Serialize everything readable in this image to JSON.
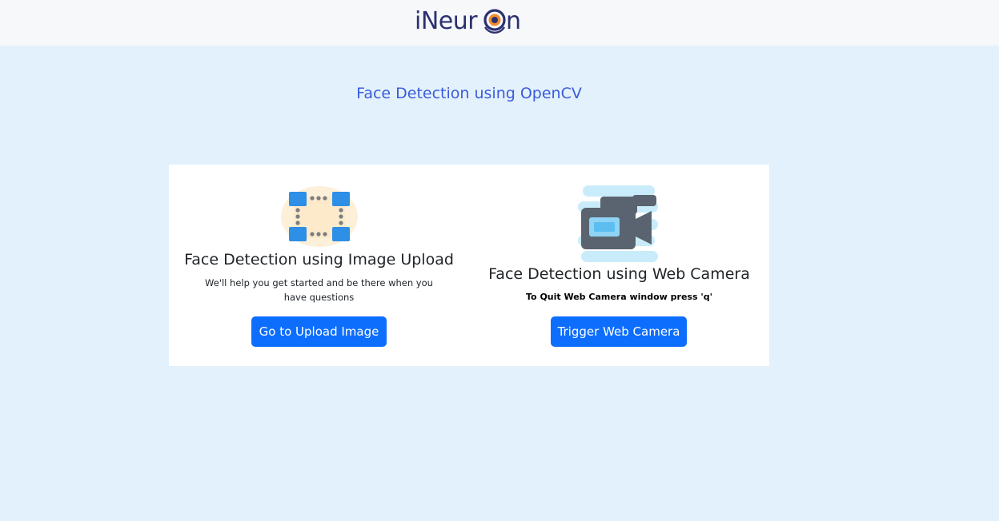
{
  "header": {
    "logo_text": "iNeuron"
  },
  "page": {
    "title": "Face Detection using OpenCV"
  },
  "cards": {
    "upload": {
      "icon": "image-upload-icon",
      "title": "Face Detection using Image Upload",
      "text": "We'll help you get started and be there when you have questions",
      "button_label": "Go to Upload Image"
    },
    "webcam": {
      "icon": "video-camera-icon",
      "title": "Face Detection using Web Camera",
      "note": "To Quit Web Camera window press 'q'",
      "button_label": "Trigger Web Camera"
    }
  },
  "colors": {
    "page_background": "#e3f1fc",
    "header_background": "#f7f8fa",
    "title_color": "#3b5bdb",
    "button_primary": "#0d6efd",
    "logo_color": "#2b3170",
    "logo_accent": "#f08c2e"
  }
}
